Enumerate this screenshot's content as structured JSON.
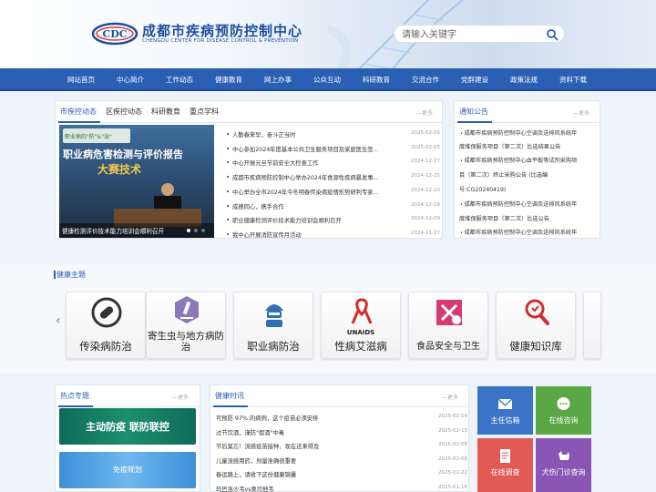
{
  "header": {
    "org_cn": "成都市疾病预防控制中心",
    "org_en": "CHENGDU CENTER FOR DISEASE CONTROL & PREVENTION",
    "logo_text": "CDC",
    "search_placeholder": "请输入关键字"
  },
  "nav": [
    "网站首页",
    "中心简介",
    "工作动态",
    "健康教育",
    "网上办事",
    "公众互动",
    "科研教育",
    "交流合作",
    "党群建设",
    "政策法规",
    "资料下载"
  ],
  "news_panel": {
    "tabs": [
      "市疾控动态",
      "区疾控动态",
      "科研教育",
      "重点学科"
    ],
    "more": "更多",
    "slide_caption": "健康检测评价技术能力培训会顺利召开",
    "slide_banner_title": "职业病危害检测与评价报告",
    "slide_banner_top": "职业病的\"防\"&\"治\"",
    "slide_banner_gold": "大赛技术",
    "items": [
      {
        "title": "人勤春来早，奋斗正当时",
        "date": "2025-02-05"
      },
      {
        "title": "中心参加2024年度基本公共卫生服务项目及家庭医生签...",
        "date": "2025-02-05"
      },
      {
        "title": "中心开展元旦节前安全大检查工作",
        "date": "2024-12-27"
      },
      {
        "title": "成都市疾病预防控制中心举办2024年食源性疾病暴发事...",
        "date": "2024-12-25"
      },
      {
        "title": "中心举办全市2024年今冬明春传染病疫情形势研判专家...",
        "date": "2024-12-20"
      },
      {
        "title": "成德同心，携手合作",
        "date": "2024-12-18"
      },
      {
        "title": "职业健康检测评价技术能力培训会顺利召开",
        "date": "2024-12-09"
      },
      {
        "title": "我中心开展消防宣传月活动",
        "date": "2024-11-27"
      }
    ]
  },
  "notice_panel": {
    "title": "通知公告",
    "more": "更多",
    "lines": [
      "成都市疾病预防控制中心空调及送排风系统年",
      "度维保服务项目（第二次）比选结果公告",
      "成都市疾病预防控制中心血平板等试剂采购项",
      "目（第二次）终止采购公告 (比选编",
      "号:CG20240419)",
      "成都市疾病预防控制中心空调及送排风系统年",
      "度维保服务项目（第二次）比选公告",
      "成都市疾病预防控制中心空调及送排风系统年"
    ]
  },
  "health_topics": {
    "title": "健康主题",
    "items": [
      "传染病防治",
      "寄生虫与地方病防治",
      "职业病防治",
      "性病艾滋病",
      "食品安全与卫生",
      "健康知识库"
    ],
    "unaids_text": "UNAIDS"
  },
  "hot_topics": {
    "title": "热点专题",
    "more": "更多",
    "banner1": "主动防疫 联防联控",
    "banner2": "免疫规划"
  },
  "health_news": {
    "title": "健康时讯",
    "more": "更多",
    "items": [
      {
        "title": "可预防 97% 的病例，这个疫苗必须安排",
        "date": "2025-02-14"
      },
      {
        "title": "过节饮酒，谨防\"假酒\"中毒",
        "date": "2025-02-13"
      },
      {
        "title": "节后莫忘！流感疫苗接种，现在还来得及",
        "date": "2025-02-08"
      },
      {
        "title": "儿童流感用药，剂量准确很重要",
        "date": "2025-02-08"
      },
      {
        "title": "春运路上，请收下这份健康锦囊",
        "date": "2025-01-22"
      },
      {
        "title": "玛巴洛沙韦vs奥司他韦",
        "date": "2025-01-16"
      }
    ]
  },
  "service_tiles": [
    {
      "label": "主任信箱",
      "color": "#3b73c6",
      "icon": "mail-icon"
    },
    {
      "label": "在线咨询",
      "color": "#5aa845",
      "icon": "chat-icon"
    },
    {
      "label": "在线调查",
      "color": "#e25a56",
      "icon": "survey-icon"
    },
    {
      "label": "犬伤门诊查询",
      "color": "#8a55b5",
      "icon": "dog-icon"
    }
  ]
}
